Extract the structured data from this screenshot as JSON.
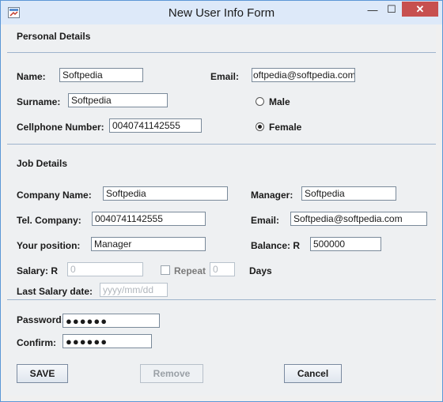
{
  "window": {
    "title": "New User Info Form",
    "min": "—",
    "max": "☐",
    "close": "✕"
  },
  "personal": {
    "title": "Personal Details",
    "name_label": "Name:",
    "name_value": "Softpedia",
    "email_label": "Email:",
    "email_value": "oftpedia@softpedia.com",
    "surname_label": "Surname:",
    "surname_value": "Softpedia",
    "cell_label": "Cellphone Number:",
    "cell_value": "0040741142555",
    "gender_male": "Male",
    "gender_female": "Female",
    "gender_selected": "Female"
  },
  "job": {
    "title": "Job Details",
    "company_label": "Company Name:",
    "company_value": "Softpedia",
    "manager_label": "Manager:",
    "manager_value": "Softpedia",
    "tel_label": "Tel. Company:",
    "tel_value": "0040741142555",
    "email_label": "Email:",
    "email_value": "Softpedia@softpedia.com",
    "position_label": "Your position:",
    "position_value": "Manager",
    "balance_label": "Balance:  R",
    "balance_value": "500000",
    "salary_label": "Salary:  R",
    "salary_value": "0",
    "repeat_label": "Repeat",
    "repeat_value": "0",
    "days_label": "Days",
    "last_salary_label": "Last Salary date:",
    "last_salary_placeholder": "yyyy/mm/dd"
  },
  "security": {
    "password_label": "Password:",
    "password_value": "●●●●●●",
    "confirm_label": "Confirm:",
    "confirm_value": "●●●●●●"
  },
  "buttons": {
    "save": "SAVE",
    "remove": "Remove",
    "cancel": "Cancel"
  }
}
